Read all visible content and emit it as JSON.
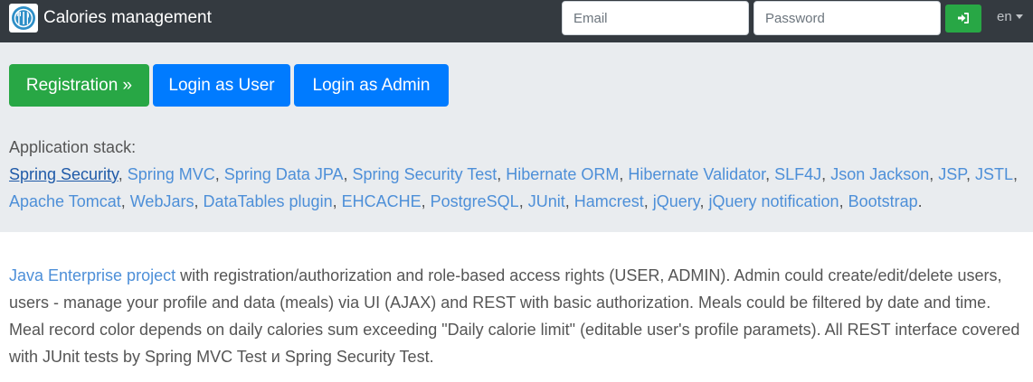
{
  "navbar": {
    "title": "Calories management",
    "logo_icon": "cutlery-icon",
    "email_placeholder": "Email",
    "password_placeholder": "Password",
    "login_icon": "sign-in-icon",
    "language": "en"
  },
  "actions": {
    "registration": "Registration »",
    "login_user": "Login as User",
    "login_admin": "Login as Admin"
  },
  "stack": {
    "heading": "Application stack:",
    "links": [
      "Spring Security",
      "Spring MVC",
      "Spring Data JPA",
      "Spring Security Test",
      "Hibernate ORM",
      "Hibernate Validator",
      "SLF4J",
      "Json Jackson",
      "JSP",
      "JSTL",
      "Apache Tomcat",
      "WebJars",
      "DataTables plugin",
      "EHCACHE",
      "PostgreSQL",
      "JUnit",
      "Hamcrest",
      "jQuery",
      "jQuery notification",
      "Bootstrap"
    ],
    "end": "."
  },
  "description": {
    "link": "Java Enterprise project",
    "text": " with registration/authorization and role-based access rights (USER, ADMIN). Admin could create/edit/delete users, users - manage your profile and data (meals) via UI (AJAX) and REST with basic authorization. Meals could be filtered by date and time. Meal record color depends on daily calories sum exceeding \"Daily calorie limit\" (editable user's profile paramets). All REST interface covered with JUnit tests by Spring MVC Test и Spring Security Test."
  },
  "colors": {
    "navbar": "#343a40",
    "success": "#28a745",
    "primary": "#007bff",
    "jumbotron": "#e9ecef",
    "link": "#4d8fd8"
  }
}
